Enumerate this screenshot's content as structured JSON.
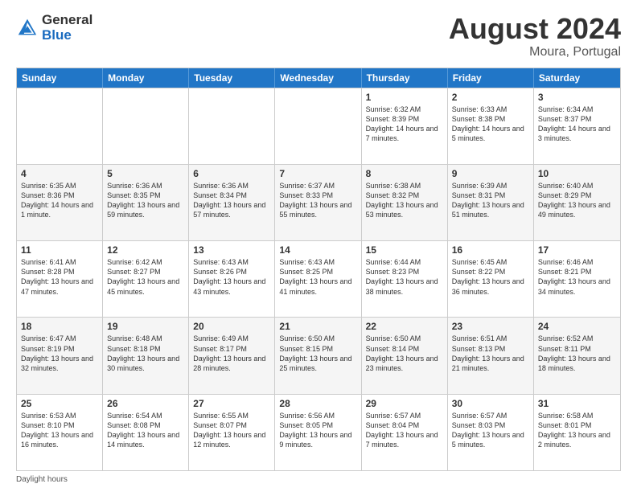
{
  "header": {
    "logo_general": "General",
    "logo_blue": "Blue",
    "title": "August 2024",
    "subtitle": "Moura, Portugal"
  },
  "calendar": {
    "days_of_week": [
      "Sunday",
      "Monday",
      "Tuesday",
      "Wednesday",
      "Thursday",
      "Friday",
      "Saturday"
    ],
    "rows": [
      [
        {
          "day": "",
          "info": ""
        },
        {
          "day": "",
          "info": ""
        },
        {
          "day": "",
          "info": ""
        },
        {
          "day": "",
          "info": ""
        },
        {
          "day": "1",
          "info": "Sunrise: 6:32 AM\nSunset: 8:39 PM\nDaylight: 14 hours and 7 minutes."
        },
        {
          "day": "2",
          "info": "Sunrise: 6:33 AM\nSunset: 8:38 PM\nDaylight: 14 hours and 5 minutes."
        },
        {
          "day": "3",
          "info": "Sunrise: 6:34 AM\nSunset: 8:37 PM\nDaylight: 14 hours and 3 minutes."
        }
      ],
      [
        {
          "day": "4",
          "info": "Sunrise: 6:35 AM\nSunset: 8:36 PM\nDaylight: 14 hours and 1 minute."
        },
        {
          "day": "5",
          "info": "Sunrise: 6:36 AM\nSunset: 8:35 PM\nDaylight: 13 hours and 59 minutes."
        },
        {
          "day": "6",
          "info": "Sunrise: 6:36 AM\nSunset: 8:34 PM\nDaylight: 13 hours and 57 minutes."
        },
        {
          "day": "7",
          "info": "Sunrise: 6:37 AM\nSunset: 8:33 PM\nDaylight: 13 hours and 55 minutes."
        },
        {
          "day": "8",
          "info": "Sunrise: 6:38 AM\nSunset: 8:32 PM\nDaylight: 13 hours and 53 minutes."
        },
        {
          "day": "9",
          "info": "Sunrise: 6:39 AM\nSunset: 8:31 PM\nDaylight: 13 hours and 51 minutes."
        },
        {
          "day": "10",
          "info": "Sunrise: 6:40 AM\nSunset: 8:29 PM\nDaylight: 13 hours and 49 minutes."
        }
      ],
      [
        {
          "day": "11",
          "info": "Sunrise: 6:41 AM\nSunset: 8:28 PM\nDaylight: 13 hours and 47 minutes."
        },
        {
          "day": "12",
          "info": "Sunrise: 6:42 AM\nSunset: 8:27 PM\nDaylight: 13 hours and 45 minutes."
        },
        {
          "day": "13",
          "info": "Sunrise: 6:43 AM\nSunset: 8:26 PM\nDaylight: 13 hours and 43 minutes."
        },
        {
          "day": "14",
          "info": "Sunrise: 6:43 AM\nSunset: 8:25 PM\nDaylight: 13 hours and 41 minutes."
        },
        {
          "day": "15",
          "info": "Sunrise: 6:44 AM\nSunset: 8:23 PM\nDaylight: 13 hours and 38 minutes."
        },
        {
          "day": "16",
          "info": "Sunrise: 6:45 AM\nSunset: 8:22 PM\nDaylight: 13 hours and 36 minutes."
        },
        {
          "day": "17",
          "info": "Sunrise: 6:46 AM\nSunset: 8:21 PM\nDaylight: 13 hours and 34 minutes."
        }
      ],
      [
        {
          "day": "18",
          "info": "Sunrise: 6:47 AM\nSunset: 8:19 PM\nDaylight: 13 hours and 32 minutes."
        },
        {
          "day": "19",
          "info": "Sunrise: 6:48 AM\nSunset: 8:18 PM\nDaylight: 13 hours and 30 minutes."
        },
        {
          "day": "20",
          "info": "Sunrise: 6:49 AM\nSunset: 8:17 PM\nDaylight: 13 hours and 28 minutes."
        },
        {
          "day": "21",
          "info": "Sunrise: 6:50 AM\nSunset: 8:15 PM\nDaylight: 13 hours and 25 minutes."
        },
        {
          "day": "22",
          "info": "Sunrise: 6:50 AM\nSunset: 8:14 PM\nDaylight: 13 hours and 23 minutes."
        },
        {
          "day": "23",
          "info": "Sunrise: 6:51 AM\nSunset: 8:13 PM\nDaylight: 13 hours and 21 minutes."
        },
        {
          "day": "24",
          "info": "Sunrise: 6:52 AM\nSunset: 8:11 PM\nDaylight: 13 hours and 18 minutes."
        }
      ],
      [
        {
          "day": "25",
          "info": "Sunrise: 6:53 AM\nSunset: 8:10 PM\nDaylight: 13 hours and 16 minutes."
        },
        {
          "day": "26",
          "info": "Sunrise: 6:54 AM\nSunset: 8:08 PM\nDaylight: 13 hours and 14 minutes."
        },
        {
          "day": "27",
          "info": "Sunrise: 6:55 AM\nSunset: 8:07 PM\nDaylight: 13 hours and 12 minutes."
        },
        {
          "day": "28",
          "info": "Sunrise: 6:56 AM\nSunset: 8:05 PM\nDaylight: 13 hours and 9 minutes."
        },
        {
          "day": "29",
          "info": "Sunrise: 6:57 AM\nSunset: 8:04 PM\nDaylight: 13 hours and 7 minutes."
        },
        {
          "day": "30",
          "info": "Sunrise: 6:57 AM\nSunset: 8:03 PM\nDaylight: 13 hours and 5 minutes."
        },
        {
          "day": "31",
          "info": "Sunrise: 6:58 AM\nSunset: 8:01 PM\nDaylight: 13 hours and 2 minutes."
        }
      ]
    ]
  },
  "footer": {
    "note": "Daylight hours"
  }
}
